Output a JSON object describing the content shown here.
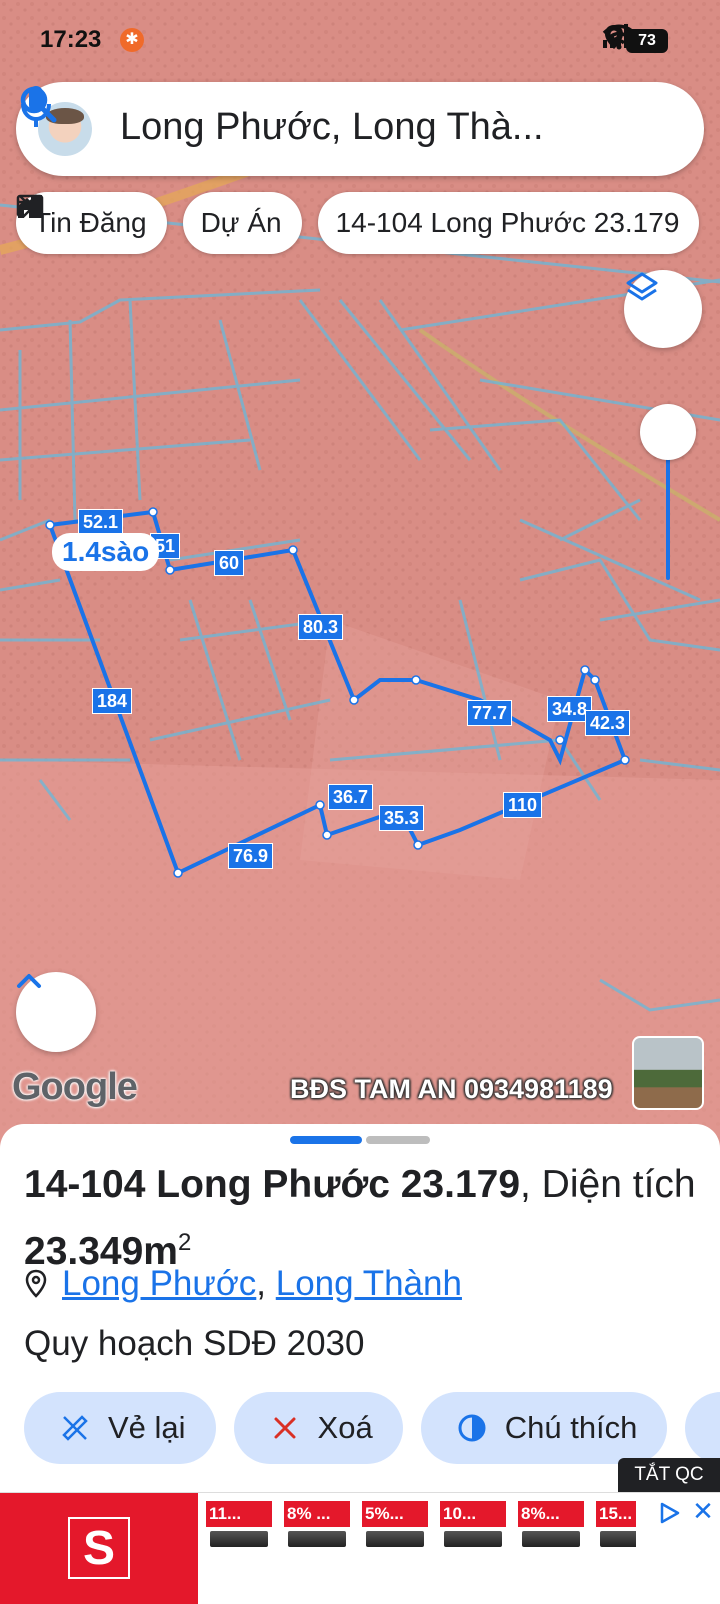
{
  "status_bar": {
    "time": "17:23",
    "battery": "73"
  },
  "search": {
    "query": "Long Phước, Long Thà..."
  },
  "chips": [
    {
      "label": "Tin Đăng",
      "icon": "listing-icon"
    },
    {
      "label": "Dự Án",
      "icon": "project-icon"
    },
    {
      "label": "14-104 Long Phước 23.179",
      "icon": "ruler-icon"
    }
  ],
  "map": {
    "area_badge": "1.4sào",
    "edge_labels": [
      "52.1",
      "51",
      "60",
      "80.3",
      "184",
      "77.7",
      "34.8",
      "42.3",
      "36.7",
      "35.3",
      "110",
      "76.9"
    ],
    "google_logo": "Google",
    "watermark": "BĐS TAM AN 0934981189",
    "colors": {
      "parcel_line": "#1a73e8",
      "zone_overlay": "#d98d85"
    }
  },
  "sheet": {
    "title_bold": "14-104 Long Phước 23.179",
    "title_rest": ", Diện tích",
    "area": "23.349m",
    "area_sup": "2",
    "location": {
      "commune": "Long Phước",
      "separator": ",",
      "district": "Long Thành"
    },
    "planning": "Quy hoạch SDĐ 2030",
    "actions": [
      {
        "label": "Vẻ lại",
        "icon": "redraw-icon"
      },
      {
        "label": "Xoá",
        "icon": "close-icon"
      },
      {
        "label": "Chú thích",
        "icon": "legend-icon"
      }
    ]
  },
  "ad": {
    "off_label": "TẮT QC",
    "brand_letter": "S",
    "deals": [
      "11...",
      "8% ...",
      "5%...",
      "10...",
      "8%...",
      "15..."
    ]
  }
}
